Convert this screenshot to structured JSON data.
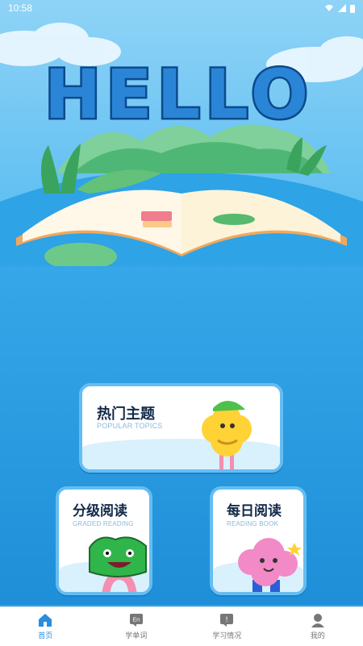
{
  "status": {
    "time": "10:58"
  },
  "hero": {
    "title": "HELLO"
  },
  "cards": [
    {
      "title": "热门主题",
      "subtitle": "POPULAR TOPICS"
    },
    {
      "title": "分级阅读",
      "subtitle": "GRADED READING"
    },
    {
      "title": "每日阅读",
      "subtitle": "READING BOOK"
    }
  ],
  "tabs": [
    {
      "label": "首页",
      "icon": "home-icon",
      "active": true
    },
    {
      "label": "学单词",
      "icon": "vocab-icon",
      "badge": "En"
    },
    {
      "label": "学习情况",
      "icon": "report-icon",
      "badge": "!"
    },
    {
      "label": "我的",
      "icon": "profile-icon"
    }
  ],
  "colors": {
    "accent": "#2a8ee0",
    "sea": "#2ea3e6",
    "card_border": "#65bdf1",
    "title_text": "#122a4a"
  }
}
